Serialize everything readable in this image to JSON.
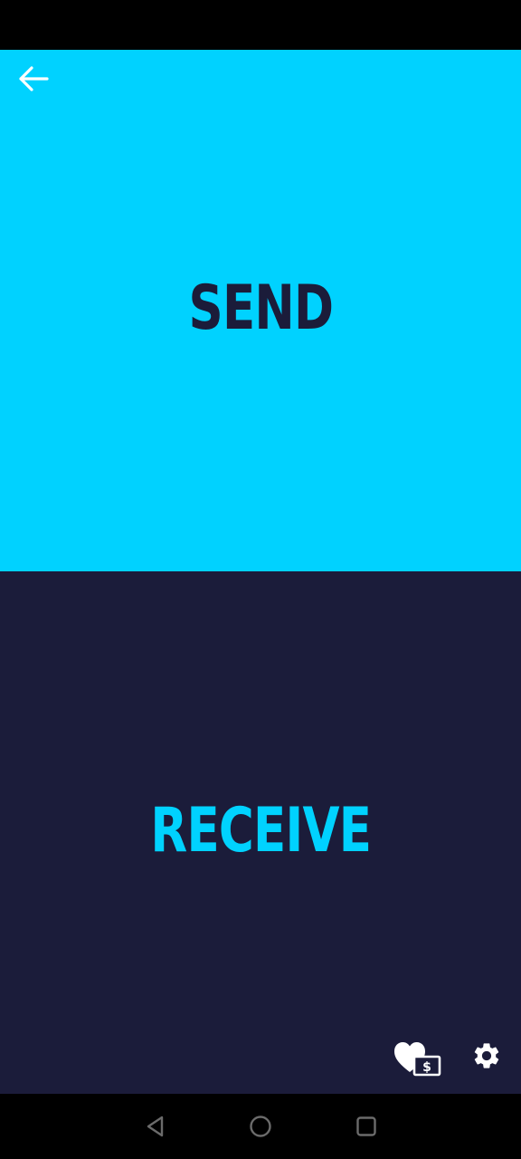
{
  "send": {
    "label": "SEND"
  },
  "receive": {
    "label": "RECEIVE"
  },
  "colors": {
    "accent": "#00d2ff",
    "dark": "#1b1c3a",
    "icon_light": "#ffffff",
    "system_bar": "#000000",
    "nav_icon": "#6b6b6b"
  },
  "icons": {
    "back": "arrow-left-icon",
    "donate": "heart-with-money-icon",
    "donate_symbol": "$",
    "settings": "gear-icon",
    "nav_back": "triangle-back-icon",
    "nav_home": "circle-home-icon",
    "nav_recents": "square-recents-icon"
  }
}
